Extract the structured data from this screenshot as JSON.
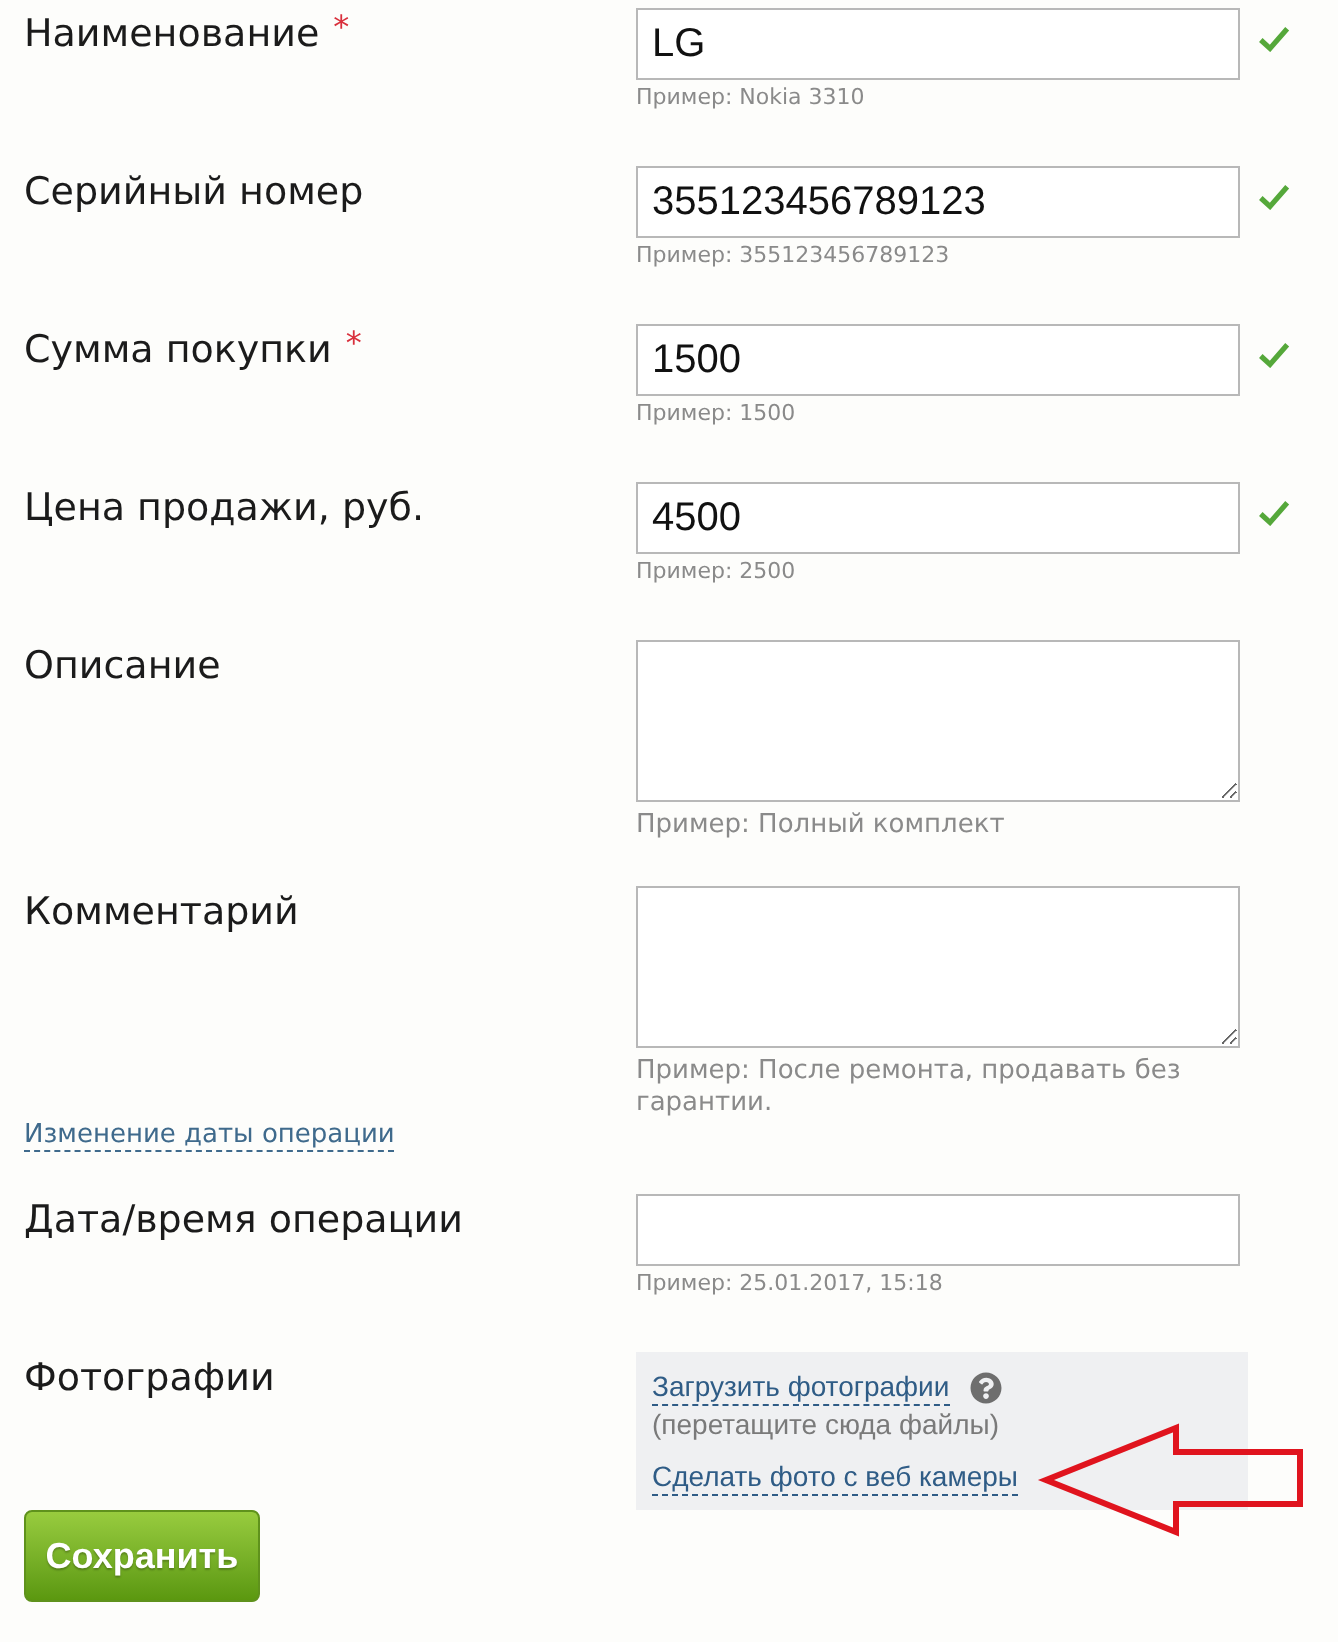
{
  "rows": [
    {
      "kind": "input",
      "label": "Наименование",
      "required_mark": "*",
      "value": "LG",
      "hint": "Пример: Nokia 3310",
      "valid": true
    },
    {
      "kind": "input",
      "label": "Серийный номер",
      "value": "355123456789123",
      "hint": "Пример: 355123456789123",
      "valid": true
    },
    {
      "kind": "input",
      "label": "Сумма покупки",
      "required_mark": "*",
      "value": "1500",
      "hint": "Пример: 1500",
      "valid": true
    },
    {
      "kind": "input",
      "label": "Цена продажи, руб.",
      "value": "4500",
      "hint": "Пример: 2500",
      "valid": true
    },
    {
      "kind": "textarea",
      "label": "Описание",
      "hint": "Пример: Полный комплект",
      "valid": false
    },
    {
      "kind": "textarea",
      "label": "Комментарий",
      "hint": "Пример: После ремонта, продавать без гарантии.",
      "valid": false
    },
    {
      "kind": "link",
      "label": "Изменение даты операции"
    },
    {
      "kind": "input",
      "label": "Дата/время операции",
      "hint": "Пример: 25.01.2017, 15:18",
      "valid": false
    },
    {
      "kind": "photos",
      "label": "Фотографии",
      "upload_link": "Загрузить фотографии",
      "drop_hint": "(перетащите сюда файлы)",
      "webcam_link": "Сделать фото с веб камеры"
    }
  ],
  "save_button": {
    "label": "Сохранить"
  }
}
